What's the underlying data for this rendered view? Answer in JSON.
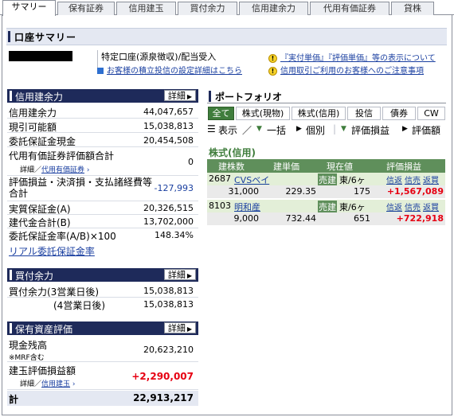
{
  "tabs": [
    "サマリー",
    "保有証券",
    "信用建玉",
    "買付余力",
    "信用建余力",
    "代用有価証券",
    "貸株"
  ],
  "page_title": "口座サマリー",
  "account_type": "特定口座(源泉徴収)/配当受入",
  "links": {
    "reserve_settings": "お客様の積立投信の設定詳細はこちら",
    "unit_price_notice": "『実付単価』『評価単価』等の表示について",
    "margin_caution": "信用取引ご利用のお客様へのご注意事項"
  },
  "margin_capacity_panel": {
    "title": "信用建余力",
    "detail_label": "詳細",
    "rows": [
      {
        "label": "信用建余力",
        "value": "44,047,657"
      },
      {
        "label": "現引可能額",
        "value": "15,038,813"
      },
      {
        "label": "委託保証金現金",
        "value": "20,454,508"
      },
      {
        "label": "代用有価証券評価額合計",
        "sub_prefix": "詳細／",
        "sub_link": "代用有価証券",
        "value": "0"
      },
      {
        "label": "評価損益・決済損・支払諸経費等合計",
        "value": "-127,993"
      },
      {
        "label": "実質保証金(A)",
        "value": "20,326,515"
      },
      {
        "label": "建代金合計(B)",
        "value": "13,702,000"
      },
      {
        "label": "委託保証金率(A/B)×100",
        "value": "148.34%"
      }
    ],
    "realtime_link": "リアル委託保証金率"
  },
  "buying_power_panel": {
    "title": "買付余力",
    "detail_label": "詳細",
    "rows": [
      {
        "label": "買付余力(3営業日後)",
        "value": "15,038,813"
      },
      {
        "label": "(4営業日後)",
        "value": "15,038,813"
      }
    ]
  },
  "assets_panel": {
    "title": "保有資産評価",
    "detail_label": "詳細",
    "cash_label": "現金残高",
    "cash_note": "※MRF含む",
    "cash_value": "20,623,210",
    "position_label": "建玉評価損益額",
    "position_sub_prefix": "詳細／",
    "position_sub_link": "信用建玉",
    "position_value": "+2,290,007",
    "total_label": "計",
    "total_value": "22,913,217"
  },
  "portfolio": {
    "title": "ポートフォリオ",
    "filters": [
      "全て",
      "株式(現物)",
      "株式(信用)",
      "投信",
      "債券",
      "CW"
    ],
    "toolbar": {
      "display": "表示",
      "separator": "／",
      "bulk": "一括",
      "individual": "個別",
      "pl": "評価損益",
      "valuation": "評価額"
    },
    "section_title": "株式(信用)",
    "columns": [
      "建株数",
      "建単価",
      "現在値",
      "評価損益"
    ],
    "positions": [
      {
        "code": "2687",
        "name": "CVSベイ",
        "side": "売建",
        "market": "東/6ヶ",
        "actions": [
          "信返",
          "信売",
          "返買"
        ],
        "qty": "31,000",
        "price": "229.35",
        "current": "175",
        "pl": "+1,567,089"
      },
      {
        "code": "8103",
        "name": "明和産",
        "side": "売建",
        "market": "東/6ヶ",
        "actions": [
          "信返",
          "信売",
          "返買"
        ],
        "qty": "9,000",
        "price": "732.44",
        "current": "651",
        "pl": "+722,918"
      }
    ]
  }
}
